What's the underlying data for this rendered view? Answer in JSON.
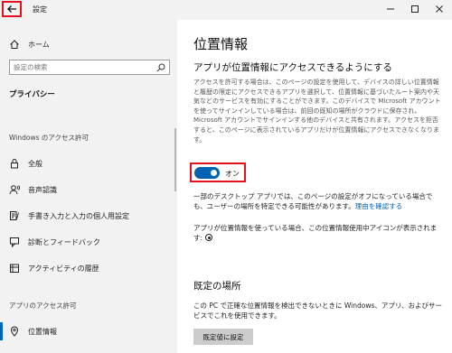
{
  "window": {
    "title": "設定"
  },
  "sidebar": {
    "home": "ホーム",
    "search_placeholder": "設定の検索",
    "section_current": "プライバシー",
    "section_windows": "Windows のアクセス許可",
    "windows_items": [
      {
        "label": "全般",
        "icon": "lock-icon"
      },
      {
        "label": "音声認識",
        "icon": "voice-icon"
      },
      {
        "label": "手書き入力と入力の個人用設定",
        "icon": "pen-icon"
      },
      {
        "label": "診断とフィードバック",
        "icon": "feedback-icon"
      },
      {
        "label": "アクティビティの履歴",
        "icon": "activity-icon"
      }
    ],
    "section_apps": "アプリのアクセス許可",
    "app_items": [
      {
        "label": "位置情報",
        "icon": "location-icon",
        "selected": true
      }
    ]
  },
  "main": {
    "title": "位置情報",
    "heading1": "アプリが位置情報にアクセスできるようにする",
    "description": "アクセスを許可する場合は、このページの設定を使用して、デバイスの詳しい位置情報と履歴の限定にアクセスできるアプリを選択して、位置情報に基づいたルート案内や天気などのサービスを有効にすることができます。このデバイスで Microsoft アカウントを使ってサインインしている場合は、前回の既知の場所がクラウドに保存され、Microsoft アカウントでサインインする他のデバイスと共有されます。アクセスを拒否すると、このページに表示されているアプリだけが位置情報にアクセスできなくなります。",
    "toggle_state": "オン",
    "toggle_on": true,
    "note_text": "一部のデスクトップ アプリでは、このページの設定がオフになっている場合でも、ユーザーの場所を特定できる可能性があります。",
    "note_link": "理由を確認する",
    "icon_question": "アプリが位置情報を使っている場合、この位置情報使用中アイコンが表示されます:",
    "heading2": "既定の場所",
    "default_desc": "この PC で正確な位置情報を検出できないときに Windows、アプリ、およびサービスでこれを使用できます。",
    "default_button": "既定値に設定"
  },
  "colors": {
    "accent": "#0063b1",
    "highlight_box": "#e8101f",
    "sidebar_bg": "#f2f2f2"
  }
}
